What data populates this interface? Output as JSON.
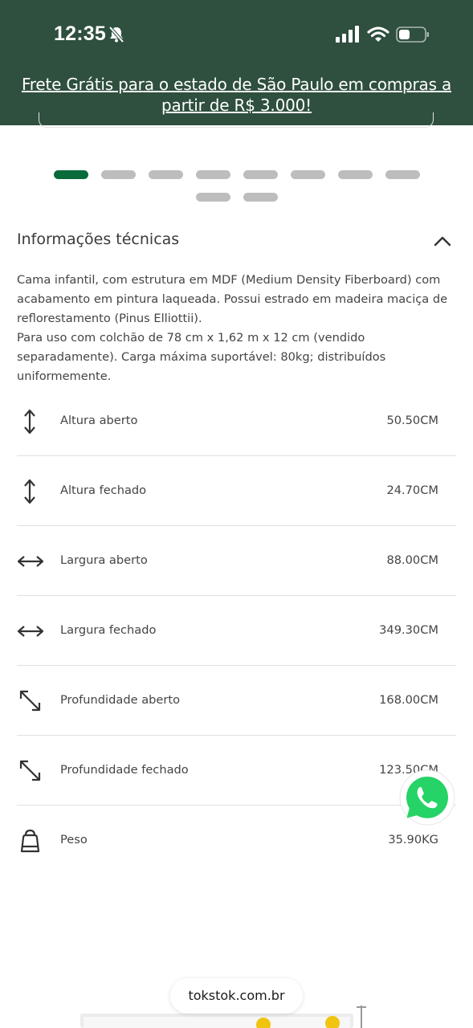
{
  "status_bar": {
    "time": "12:35",
    "icons": [
      "bell-slash-icon",
      "cellular-signal-icon",
      "wifi-icon",
      "battery-icon"
    ]
  },
  "promo_banner": {
    "line1": "Frete Grátis para o estado de São Paulo em compras a",
    "line2": "partir de R$ 3.000!"
  },
  "carousel": {
    "active_index": 0,
    "total": 10
  },
  "tech_section": {
    "title": "Informações técnicas",
    "expanded": true,
    "description": [
      "Cama infantil, com estrutura em MDF (Medium Density Fiberboard) com",
      "acabamento em pintura laqueada. Possui estrado em madeira maciça de",
      "reflorestamento (Pinus Elliottii).",
      "Para uso com colchão de 78 cm x 1,62 m x 12 cm (vendido",
      "separadamente). Carga máxima suportável: 80kg; distribuídos",
      "uniformemente."
    ],
    "specs": [
      {
        "icon": "vertical-arrows-icon",
        "label": "Altura aberto",
        "value": "50.50CM"
      },
      {
        "icon": "vertical-arrows-icon",
        "label": "Altura fechado",
        "value": "24.70CM"
      },
      {
        "icon": "horizontal-arrows-icon",
        "label": "Largura aberto",
        "value": "88.00CM"
      },
      {
        "icon": "horizontal-arrows-icon",
        "label": "Largura fechado",
        "value": "349.30CM"
      },
      {
        "icon": "diagonal-arrows-icon",
        "label": "Profundidade aberto",
        "value": "168.00CM"
      },
      {
        "icon": "diagonal-arrows-icon",
        "label": "Profundidade fechado",
        "value": "123.50CM"
      },
      {
        "icon": "weight-icon",
        "label": "Peso",
        "value": "35.90KG"
      }
    ]
  },
  "browser": {
    "url": "tokstok.com.br"
  },
  "colors": {
    "header_bg": "#2f4f3f",
    "active_dot": "#0a6b3a",
    "inactive_dot": "#bdbdbd",
    "whatsapp": "#25d366"
  }
}
